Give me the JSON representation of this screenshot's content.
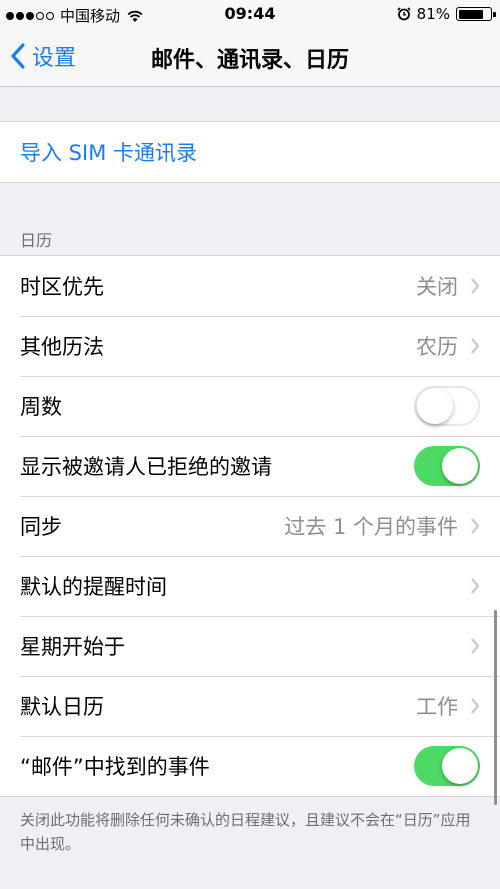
{
  "status_bar": {
    "carrier": "中国移动",
    "time": "09:44",
    "battery_percent": "81%",
    "battery_level": 0.81
  },
  "nav": {
    "back_label": "设置",
    "title": "邮件、通讯录、日历"
  },
  "contacts": {
    "import_sim_label": "导入 SIM 卡通讯录"
  },
  "calendar": {
    "section_header": "日历",
    "rows": [
      {
        "label": "时区优先",
        "value": "关闭"
      },
      {
        "label": "其他历法",
        "value": "农历"
      },
      {
        "label": "周数",
        "toggle": false
      },
      {
        "label": "显示被邀请人已拒绝的邀请",
        "toggle": true
      },
      {
        "label": "同步",
        "value": "过去 1 个月的事件"
      },
      {
        "label": "默认的提醒时间",
        "value": ""
      },
      {
        "label": "星期开始于",
        "value": ""
      },
      {
        "label": "默认日历",
        "value": "工作"
      },
      {
        "label": "“邮件”中找到的事件",
        "toggle": true
      }
    ],
    "footer": "关闭此功能将删除任何未确认的日程建议，且建议不会在“日历”应用中出现。"
  },
  "colors": {
    "accent": "#1a7cf5",
    "toggle_on": "#4cd964"
  }
}
